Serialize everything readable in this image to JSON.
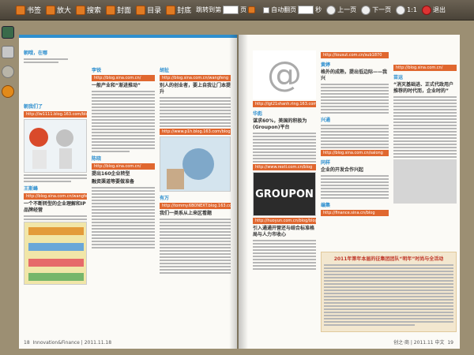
{
  "toolbar": {
    "bookmark": "书签",
    "zoom_in": "放大",
    "search": "搜索",
    "cover": "封面",
    "toc": "目录",
    "back_cover": "封底",
    "goto_label": "跳转到第",
    "page_suffix": "页",
    "auto_flip": "自动翻页",
    "seconds": "秒",
    "prev": "上一页",
    "next": "下一页",
    "zoom_level": "1:1",
    "exit": "退出"
  },
  "left_page": {
    "col1": {
      "blog_name": "朝哦，在哪",
      "headings": [
        "朝我们了",
        "王斯峰"
      ],
      "urls": [
        "http://lw1111.blog.163.com/blog",
        "http://blog.sina.com.cn/wangfeng"
      ],
      "article_title": "一个不断转型的企业理解和IP品牌经营"
    },
    "col2": {
      "headings": [
        "李锐",
        "陈晓"
      ],
      "urls": [
        "http://blog.sina.com.cn/",
        "http://blog.sina.com.cn/"
      ],
      "article_titles": [
        "一般产业和“渐进推动”",
        "提出160企业转型",
        "融资渠道等要做准备"
      ]
    },
    "col3": {
      "headings": [
        "胡扯",
        "有万"
      ],
      "urls": [
        "http://blog.sina.com.cn/wangfeng",
        "http://www.p1h.blog.163.com/blog",
        "http://tommy.6BONEXT.blog.163.com/blog"
      ],
      "article_titles": [
        "别人的创业者，要上自我让门本提升",
        "我们一类系从上来区看题"
      ]
    },
    "footer": {
      "page_number": "18",
      "magazine": "Innovation&Finance | 2011.11.18"
    }
  },
  "right_page": {
    "col1": {
      "headings": [
        "华彪"
      ],
      "urls": [
        "http://lgt21shanh.ring.163.com/blog",
        "http://www.rexti.com.cn/blog",
        "http://huoyun.com.cn/blog/blog"
      ],
      "article_titles": [
        "谋求60%，美国的积极为(Groupon)平台",
        "引入通通开营还与结合标准格局与人力市收心"
      ],
      "groupon_logo": "GROUPON"
    },
    "col2": {
      "headings": [
        "黄婷",
        "兴通",
        "同样",
        "编集"
      ],
      "urls": [
        "http://tousut.com.cn/sub1870",
        "http://blog.sina.com.cn/salong",
        "http://finance.sina.cn/blog"
      ],
      "article_titles": [
        "格外的成熟，提出低边际——我兴",
        "企业的开发合作兴起"
      ],
      "box_title": "2011年第年本届的征集团团队“明年”时尚与全活动"
    },
    "col3": {
      "headings": [
        "苗运"
      ],
      "urls": [
        "http://blog.sina.com.cn/"
      ],
      "article_titles": [
        "“消灭基础进、正式代政用户推荐的时代而，企业时的”"
      ]
    },
    "footer": {
      "page_number": "19",
      "magazine": "创之·商 | 2011.11 中文"
    }
  },
  "colors": {
    "accent_blue": "#2e8fcf",
    "url_orange": "#e0672f",
    "toolbar_bg": "#5a5245",
    "desk": "#9c8f73"
  }
}
